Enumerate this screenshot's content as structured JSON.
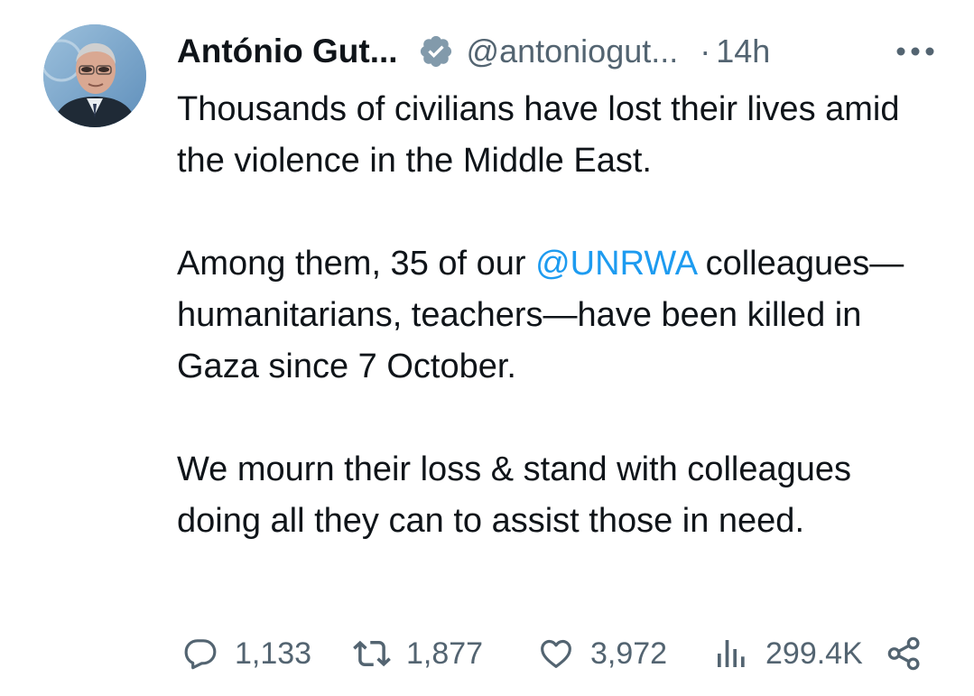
{
  "author": {
    "display_name": "António Gut...",
    "handle": "@antoniogut...",
    "separator": "·",
    "time": "14h",
    "verified_icon": "verified-badge-icon",
    "avatar": "profile-photo"
  },
  "tweet": {
    "p1": "Thousands of civilians have lost their lives amid the violence in the Middle East.",
    "p2_before": "Among them, 35 of our ",
    "p2_mention": "@UNRWA",
    "p2_after": " colleagues—humanitarians, teachers—have been killed in Gaza since 7 October.",
    "p3": "We mourn their loss & stand with colleagues doing all they can to assist those in need."
  },
  "actions": {
    "reply": {
      "icon": "reply-bubble-icon",
      "count": "1,133"
    },
    "retweet": {
      "icon": "retweet-icon",
      "count": "1,877"
    },
    "like": {
      "icon": "heart-icon",
      "count": "3,972"
    },
    "views": {
      "icon": "views-bar-chart-icon",
      "count": "299.4K"
    },
    "share": {
      "icon": "share-icon"
    }
  },
  "colors": {
    "text": "#0f1419",
    "secondary": "#536471",
    "mention": "#1d9bf0",
    "verified": "#829aab"
  }
}
